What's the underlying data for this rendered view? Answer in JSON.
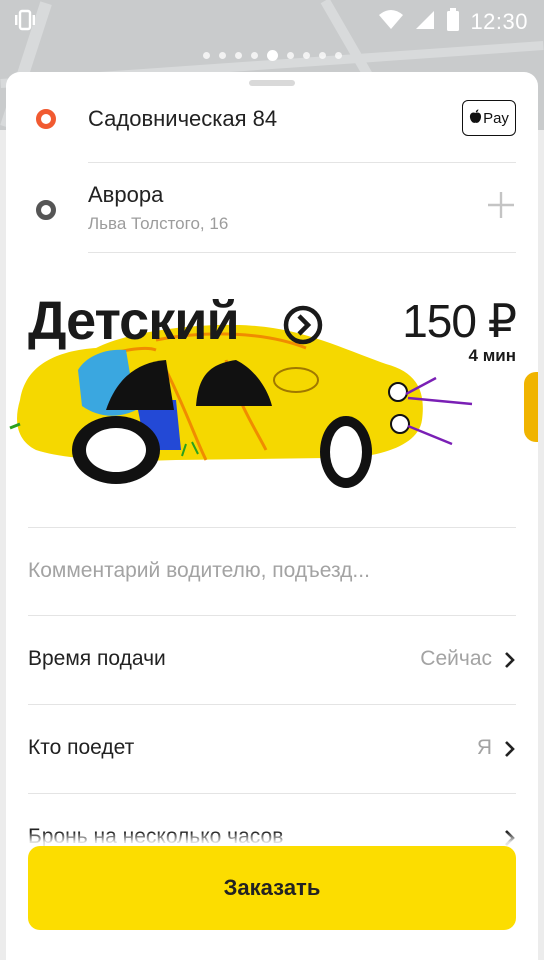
{
  "status_bar": {
    "time": "12:30",
    "icons": [
      "vibrate-icon",
      "wifi-icon",
      "signal-icon",
      "battery-icon"
    ]
  },
  "pager": {
    "count": 9,
    "active_index": 4
  },
  "route": {
    "from": {
      "title": "Садовническая 84"
    },
    "to": {
      "title": "Аврора",
      "subtitle": "Льва Толстого, 16"
    },
    "payment_badge": {
      "label": "Pay",
      "icon": "apple-icon"
    }
  },
  "tariff": {
    "name": "Детский",
    "price": "150 ₽",
    "eta": "4 мин",
    "info_icon": "chevron-circle-icon"
  },
  "comment": {
    "placeholder": "Комментарий водителю, подъезд..."
  },
  "options": [
    {
      "label": "Время подачи",
      "value": "Сейчас"
    },
    {
      "label": "Кто поедет",
      "value": "Я"
    },
    {
      "label": "Бронь на несколько часов",
      "value": ""
    }
  ],
  "order_button": {
    "label": "Заказать"
  },
  "colors": {
    "accent_yellow": "#fcdd00",
    "origin_marker": "#f15a31",
    "destination_marker": "#555555",
    "muted_text": "#a3a3a3"
  }
}
